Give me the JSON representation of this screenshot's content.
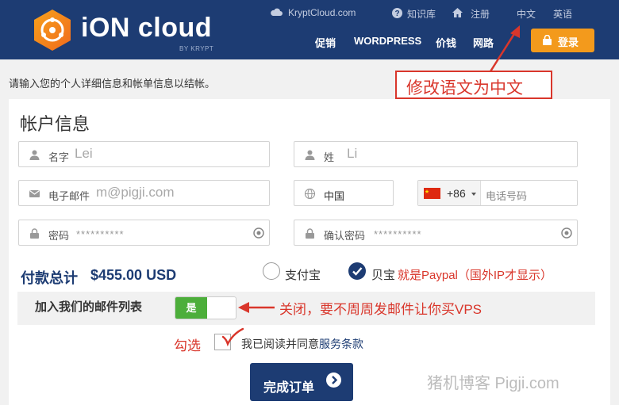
{
  "header": {
    "brand": "iON cloud",
    "brand_sub": "BY KRYPT",
    "top_links": {
      "kryptcloud": "KryptCloud.com",
      "kb": "知识库",
      "register": "注册",
      "lang_zh": "中文",
      "lang_en": "英语"
    },
    "nav": [
      "促销",
      "WORDPRESS",
      "价钱",
      "网路"
    ],
    "login": "登录",
    "icons": [
      "logo-icon",
      "cloud-icon",
      "question-icon",
      "home-icon",
      "lock-icon"
    ],
    "colors": {
      "bg": "#1d3c73",
      "login_btn": "#f39a1c"
    }
  },
  "annotations": {
    "language_note": "修改语文为中文",
    "mail_note": "关闭，要不周周发邮件让你买VPS",
    "check_note": "勾选",
    "paypal_note": "就是Paypal（国外IP才显示）",
    "color": "#d9362b"
  },
  "form": {
    "intro": "请输入您的个人详细信息和帐单信息以结帐。",
    "title": "帐户信息",
    "first_name": {
      "label": "名字",
      "value": "Lei"
    },
    "last_name": {
      "label": "姓",
      "value": "Li"
    },
    "email": {
      "label": "电子邮件",
      "value": "m@pigji.com"
    },
    "country": "中国",
    "phone": {
      "code": "+86",
      "placeholder": "电话号码"
    },
    "password": {
      "label": "密码",
      "mask": "**********"
    },
    "confirm_password": {
      "label": "确认密码",
      "mask": "**********"
    }
  },
  "payment": {
    "total_label": "付款总计",
    "total_value": "$455.00 USD",
    "options": [
      {
        "label": "支付宝",
        "selected": false
      },
      {
        "label": "贝宝",
        "selected": true
      }
    ]
  },
  "mailing": {
    "label": "加入我们的邮件列表",
    "toggle_on": "是"
  },
  "agreement": {
    "prefix": "我已阅读并同意",
    "link": "服务条款"
  },
  "submit": "完成订单",
  "watermark": "猪机博客 Pigji.com"
}
